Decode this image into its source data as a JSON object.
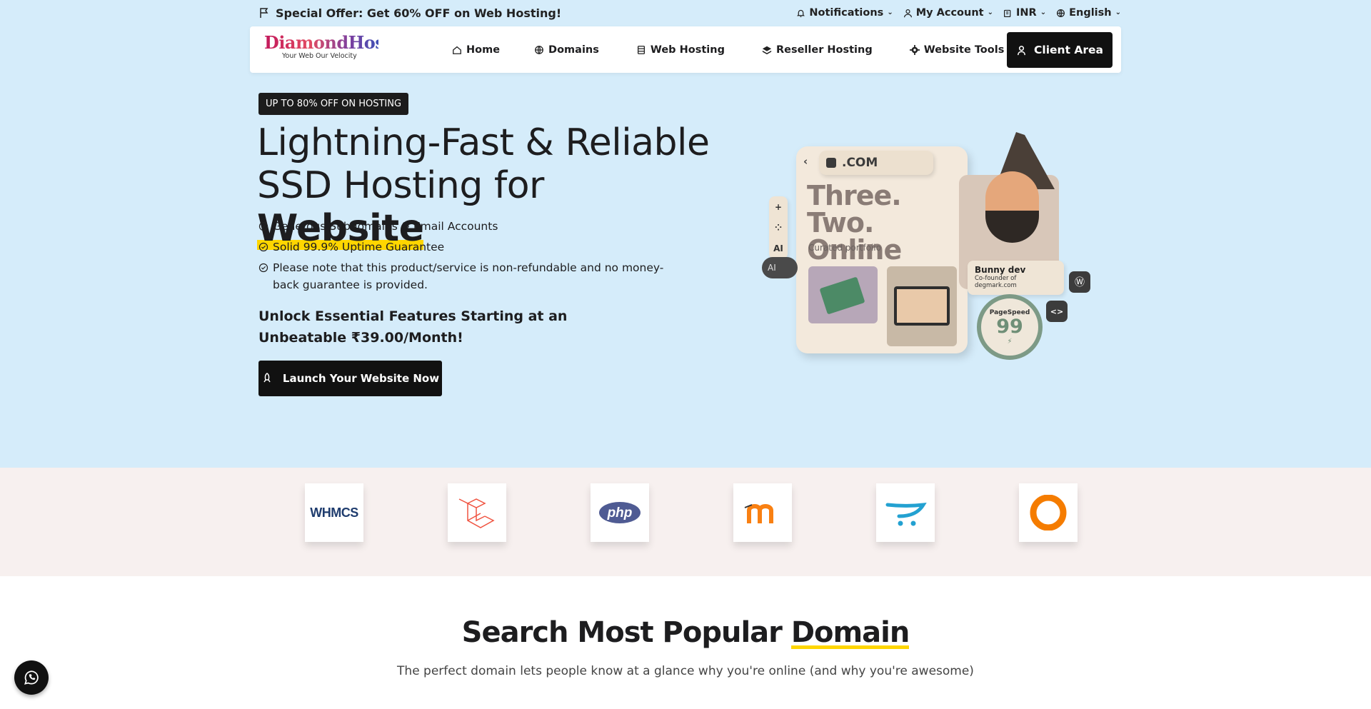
{
  "topbar": {
    "offer_text": "Special Offer: Get 60% OFF on Web Hosting!",
    "menus": [
      {
        "label": "Notifications",
        "icon": "bell-icon"
      },
      {
        "label": "My Account",
        "icon": "user-icon"
      },
      {
        "label": "INR",
        "icon": "currency-icon"
      },
      {
        "label": "English",
        "icon": "globe-icon"
      }
    ]
  },
  "nav": {
    "logo_text": "DiamondHost",
    "logo_tagline": "Your Web Our Velocity",
    "links": [
      {
        "label": "Home",
        "icon": "home-icon"
      },
      {
        "label": "Domains",
        "icon": "globe-icon"
      },
      {
        "label": "Web Hosting",
        "icon": "server-icon"
      },
      {
        "label": "Reseller Hosting",
        "icon": "layers-icon"
      },
      {
        "label": "Website Tools",
        "icon": "gear-icon"
      }
    ],
    "client_area_label": "Client Area"
  },
  "hero": {
    "badge": "UP TO 80% OFF ON HOSTING",
    "headline_part1": "Lightning-Fast & Reliable SSD Hosting for ",
    "headline_highlight": "Website",
    "features": [
      "Generous Subdomains & Email Accounts",
      "Solid 99.9% Uptime Guarantee",
      "Please note that this product/service is non-refundable and no money-back guarantee is provided."
    ],
    "price_text": "Unlock Essential Features Starting at an Unbeatable ₹39.00/Month!",
    "cta_label": "Launch Your Website Now",
    "illustration": {
      "domain": ".COM",
      "title": "Three. Two. Online",
      "subtitle": "Curated portfolio",
      "ai_label": "AI",
      "ai_pill": "AI",
      "person_name": "Bunny dev",
      "person_role": "Co-founder of degmark.com",
      "gauge_label": "PageSpeed",
      "gauge_value": "99"
    }
  },
  "tech_logos": [
    {
      "name": "WHMCS",
      "text": "WHMCS"
    },
    {
      "name": "Laravel"
    },
    {
      "name": "PHP",
      "text": "php"
    },
    {
      "name": "Moodle"
    },
    {
      "name": "OpenCart"
    },
    {
      "name": "Opera"
    }
  ],
  "domain_section": {
    "title_part1": "Search Most Popular ",
    "title_highlight": "Domain",
    "subtitle": "The perfect domain lets people know at a glance why you're online (and why you're awesome)"
  },
  "colors": {
    "hero_bg": "#d5ecfa",
    "accent_yellow": "#ffd600",
    "button_dark": "#111111",
    "strip_bg": "#f7f0ef"
  }
}
